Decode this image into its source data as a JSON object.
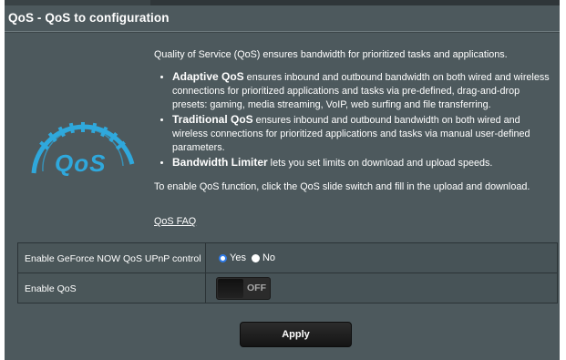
{
  "page": {
    "title": "QoS - QoS to configuration"
  },
  "logo": {
    "text": "QoS"
  },
  "description": {
    "intro": "Quality of Service (QoS) ensures bandwidth for prioritized tasks and applications.",
    "bullets": [
      {
        "bold": "Adaptive QoS",
        "text": " ensures inbound and outbound bandwidth on both wired and wireless connections for prioritized applications and tasks via pre-defined, drag-and-drop presets: gaming, media streaming, VoIP, web surfing and file transferring."
      },
      {
        "bold": "Traditional QoS",
        "text": " ensures inbound and outbound bandwidth on both wired and wireless connections for prioritized applications and tasks via manual user-defined parameters."
      },
      {
        "bold": "Bandwidth Limiter",
        "text": " lets you set limits on download and upload speeds."
      }
    ],
    "instruction": "To enable QoS function, click the QoS slide switch and fill in the upload and download.",
    "faq_link": "QoS FAQ"
  },
  "settings": {
    "geforce": {
      "label": "Enable GeForce NOW QoS UPnP control",
      "options": [
        "Yes",
        "No"
      ],
      "selected": "Yes"
    },
    "qos": {
      "label": "Enable QoS",
      "toggle_text": "OFF",
      "enabled": false
    }
  },
  "actions": {
    "apply_label": "Apply"
  },
  "colors": {
    "panel_bg": "#4d595d",
    "accent": "#2f7be8",
    "logo_blue": "#2fa8dc"
  }
}
